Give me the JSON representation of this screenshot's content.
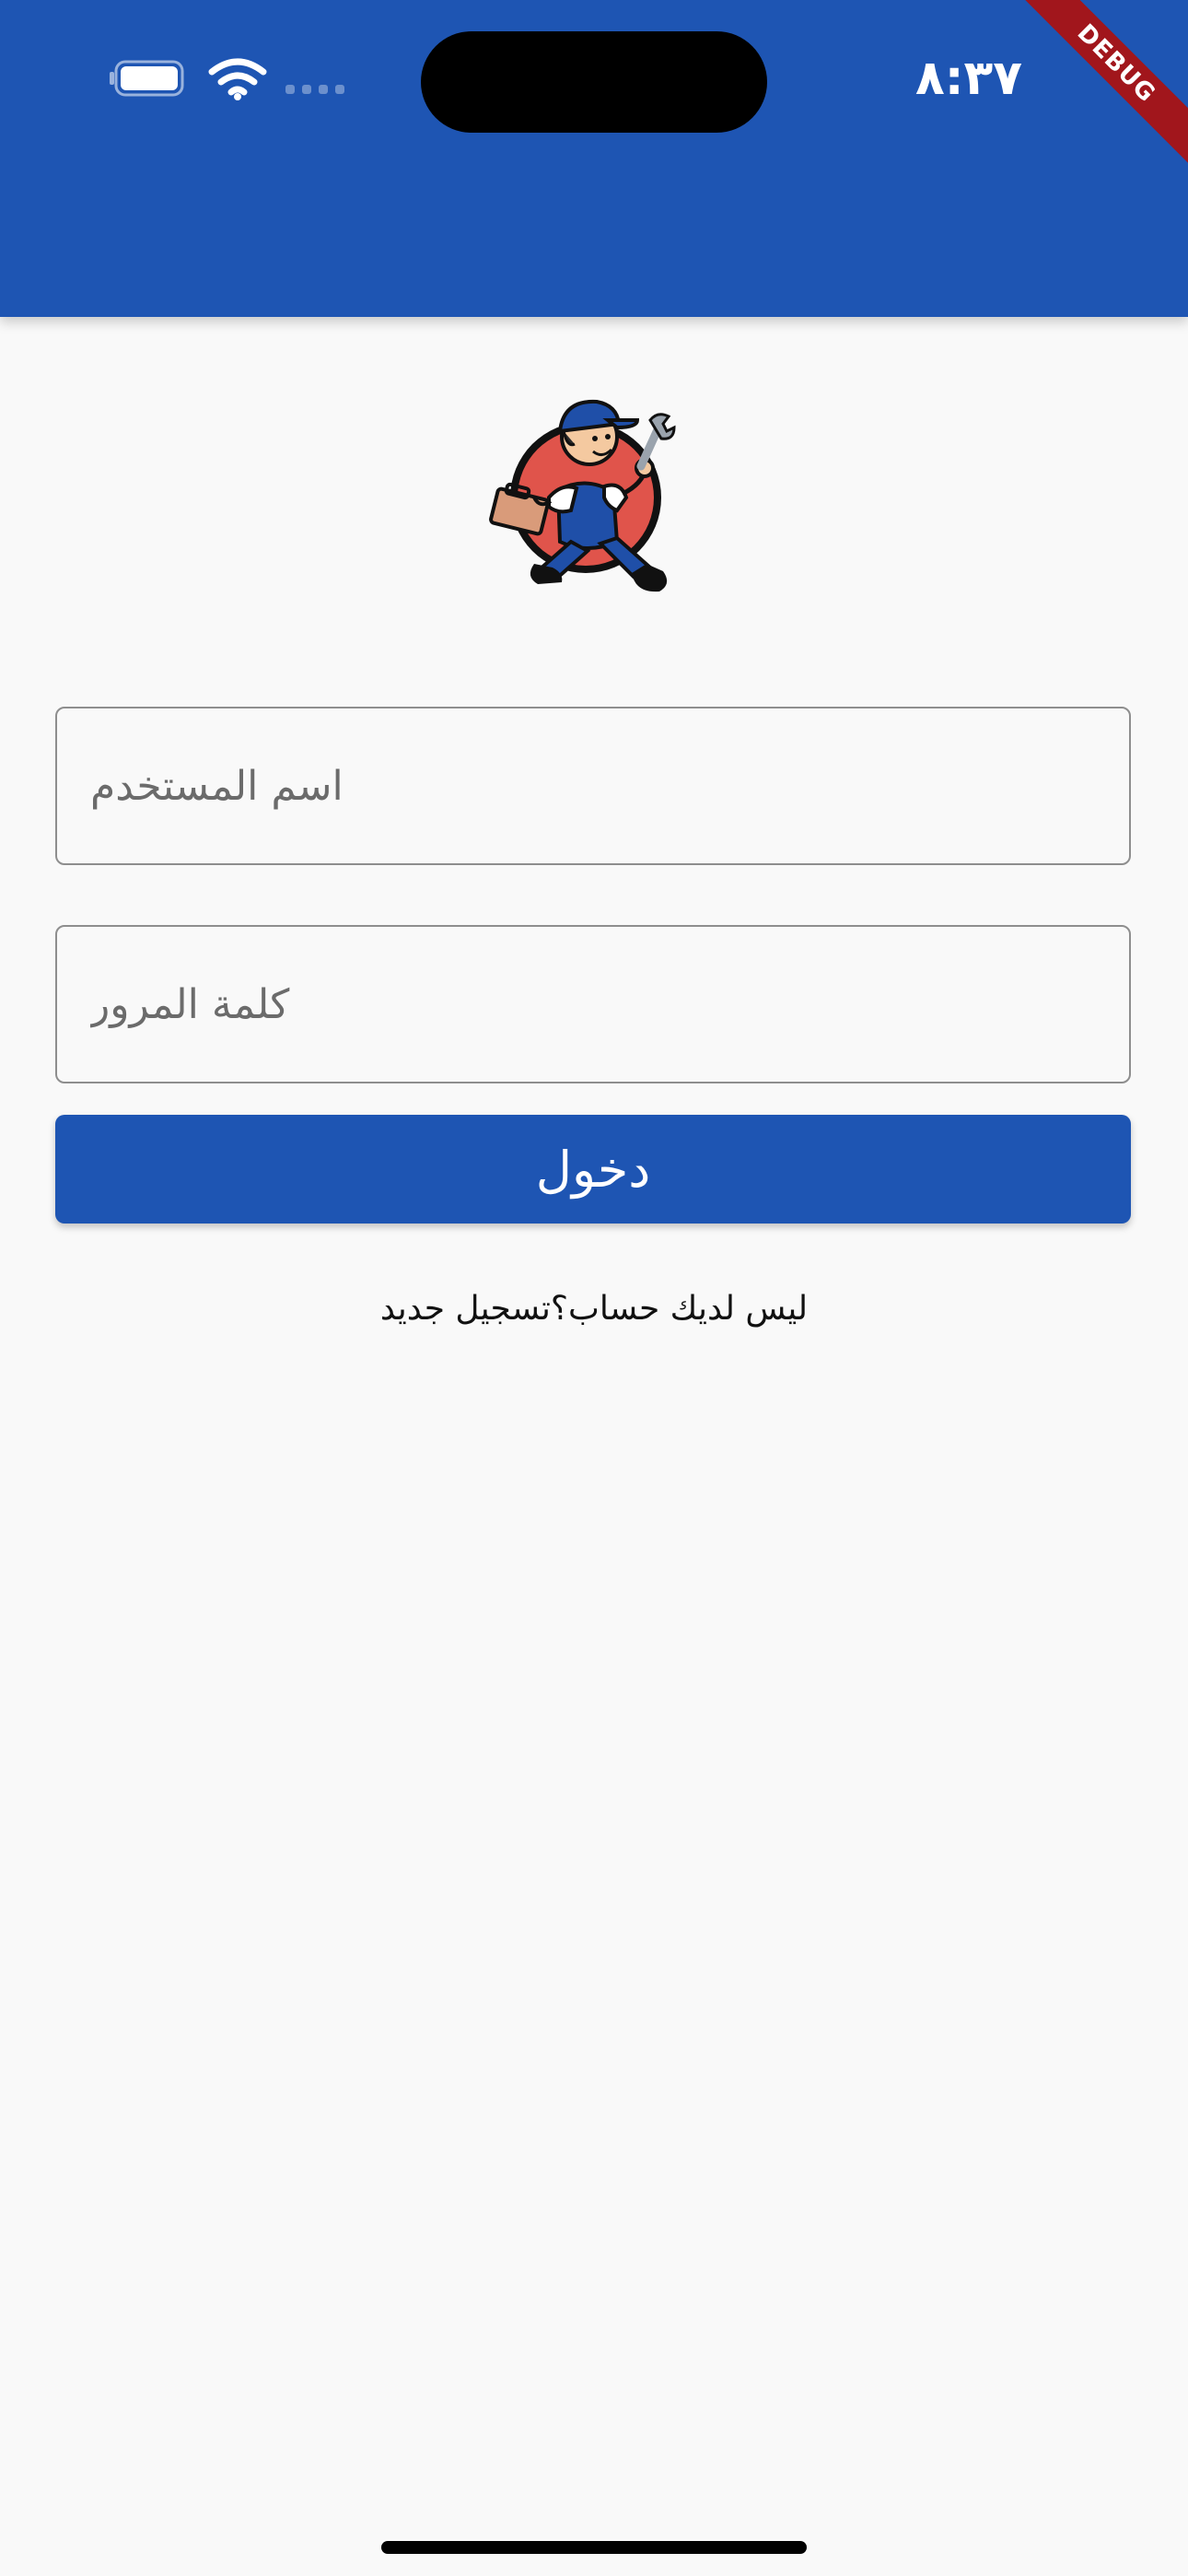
{
  "status_bar": {
    "time": "٨:٣٧",
    "icons": [
      "battery-icon",
      "wifi-icon",
      "cellular-signal-icon"
    ]
  },
  "debug_banner": {
    "label": "DEBUG",
    "color": "#a1161c"
  },
  "colors": {
    "primary": "#1e55b3",
    "background": "#f9f9f9",
    "on_primary": "#ffffff"
  },
  "logo": {
    "icon": "handyman-mascot-logo"
  },
  "form": {
    "username": {
      "placeholder": "اسم المستخدم",
      "value": ""
    },
    "password": {
      "placeholder": "كلمة المرور",
      "value": ""
    },
    "login_label": "دخول"
  },
  "register": {
    "question": "ليس لديك حساب؟",
    "link_label": "تسجيل جديد"
  }
}
